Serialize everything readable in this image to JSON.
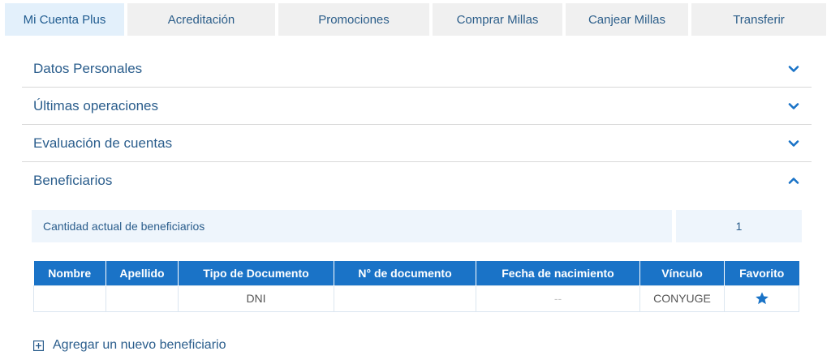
{
  "tabs": [
    {
      "label": "Mi Cuenta Plus",
      "active": true
    },
    {
      "label": "Acreditación",
      "active": false
    },
    {
      "label": "Promociones",
      "active": false
    },
    {
      "label": "Comprar Millas",
      "active": false
    },
    {
      "label": "Canjear Millas",
      "active": false
    },
    {
      "label": "Transferir",
      "active": false
    }
  ],
  "accordion": {
    "datos_personales": {
      "title": "Datos Personales",
      "state": "collapsed",
      "icon": "chevron-down-icon"
    },
    "ultimas_operaciones": {
      "title": "Últimas operaciones",
      "state": "collapsed",
      "icon": "chevron-down-icon"
    },
    "evaluacion_cuentas": {
      "title": "Evaluación de cuentas",
      "state": "collapsed",
      "icon": "chevron-down-icon"
    },
    "beneficiarios": {
      "title": "Beneficiarios",
      "state": "expanded",
      "icon": "chevron-up-icon"
    }
  },
  "beneficiarios": {
    "summary_label": "Cantidad actual de beneficiarios",
    "summary_value": "1",
    "table": {
      "headers": {
        "nombre": "Nombre",
        "apellido": "Apellido",
        "tipo_documento": "Tipo de Documento",
        "numero_documento": "N° de documento",
        "fecha_nacimiento": "Fecha de nacimiento",
        "vinculo": "Vínculo",
        "favorito": "Favorito"
      },
      "rows": [
        {
          "nombre": "",
          "apellido": "",
          "tipo_documento": "DNI",
          "numero_documento": "",
          "fecha_nacimiento": "--",
          "vinculo": "CONYUGE",
          "favorito_icon": "star-icon"
        }
      ]
    },
    "add_label": "Agregar un nuevo beneficiario"
  },
  "colors": {
    "accent": "#1a73c7",
    "text": "#2a5d8c",
    "tab_bg": "#f0f0f0",
    "tab_active_bg": "#e3f0fb",
    "summary_bg": "#eef5fc"
  }
}
